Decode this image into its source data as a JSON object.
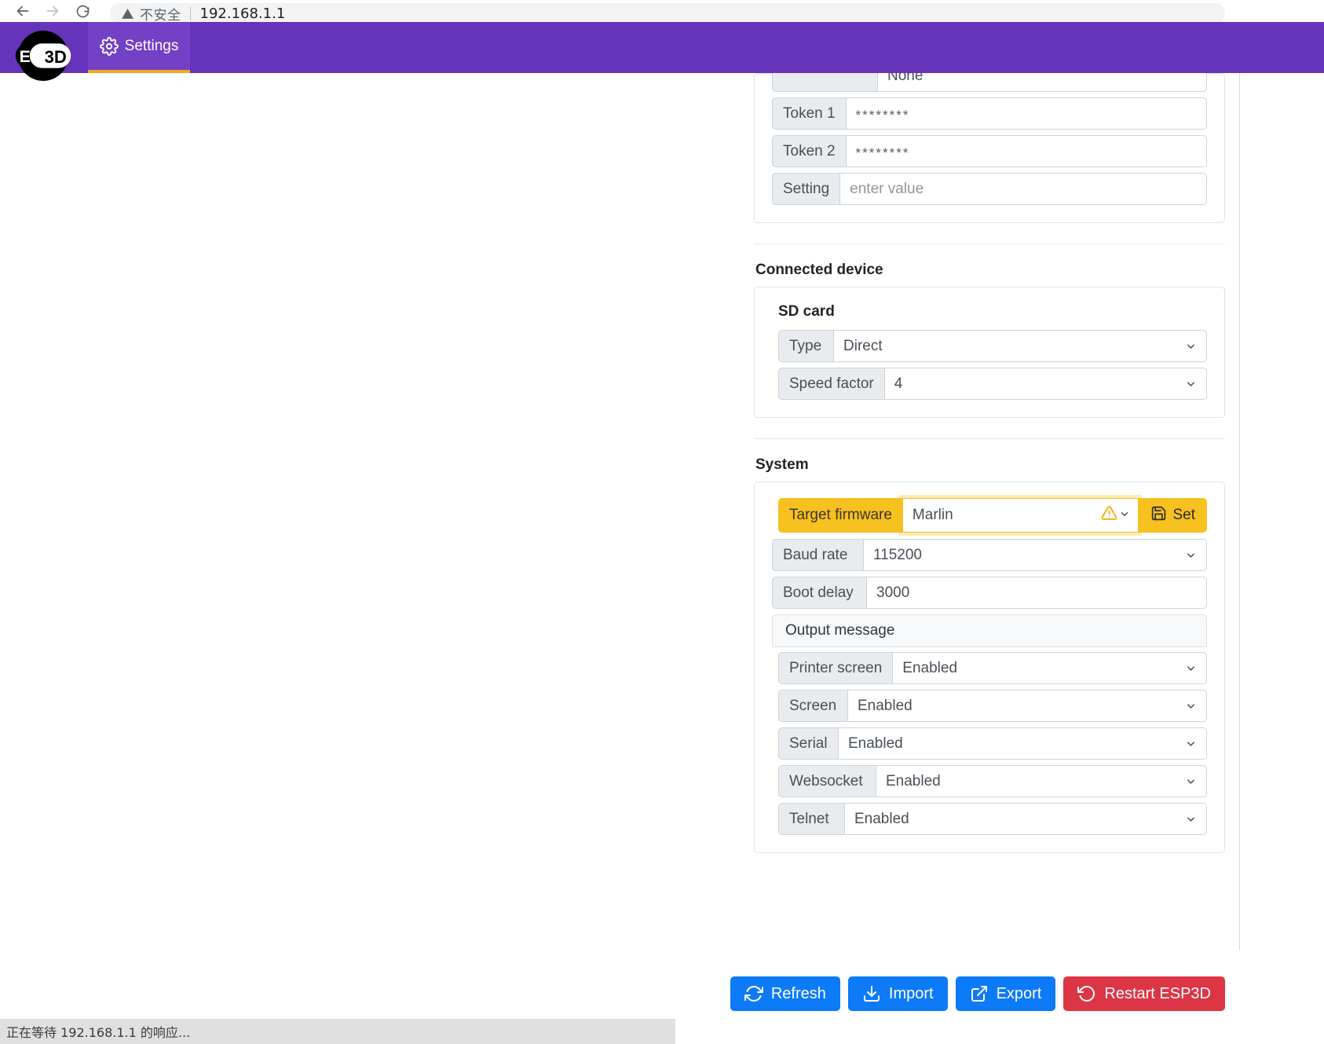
{
  "browser": {
    "back_icon": "arrow-left-icon",
    "forward_icon": "arrow-right-icon",
    "reload_icon": "reload-icon",
    "insecure_icon": "warning-triangle-icon",
    "insecure_label": "不安全",
    "url": "192.168.1.1"
  },
  "header": {
    "logo_text_left": "ESP",
    "logo_text_right": "3D",
    "tab_label": "Settings",
    "tab_icon": "gear-icon",
    "accent_color": "#6633bb",
    "tab_active_color": "#7340c6",
    "tab_underline_color": "#f5a623"
  },
  "auth_panel": {
    "partial_row": {
      "label": "",
      "value": "None"
    },
    "rows": [
      {
        "label": "Token 1",
        "value": "********",
        "type": "password"
      },
      {
        "label": "Token 2",
        "value": "********",
        "type": "password"
      },
      {
        "label": "Setting",
        "value": "enter value",
        "type": "placeholder"
      }
    ]
  },
  "connected_device": {
    "title": "Connected device",
    "sd_card": {
      "title": "SD card",
      "rows": [
        {
          "label": "Type",
          "value": "Direct",
          "type": "select"
        },
        {
          "label": "Speed factor",
          "value": "4",
          "type": "select"
        }
      ]
    }
  },
  "system": {
    "title": "System",
    "target_firmware": {
      "label": "Target firmware",
      "value": "Marlin",
      "warning_icon": "warning-triangle-icon",
      "chevron_icon": "chevron-down-icon",
      "set_button_label": "Set",
      "set_button_icon": "save-icon",
      "highlight_color": "#f7c11f"
    },
    "rows": [
      {
        "label": "Baud rate",
        "value": "115200",
        "type": "select"
      },
      {
        "label": "Boot delay",
        "value": "3000",
        "type": "text"
      }
    ],
    "output_message": {
      "title": "Output message",
      "rows": [
        {
          "label": "Printer screen",
          "value": "Enabled",
          "type": "select"
        },
        {
          "label": "Screen",
          "value": "Enabled",
          "type": "select"
        },
        {
          "label": "Serial",
          "value": "Enabled",
          "type": "select"
        },
        {
          "label": "Websocket",
          "value": "Enabled",
          "type": "select"
        },
        {
          "label": "Telnet",
          "value": "Enabled",
          "type": "select"
        }
      ]
    }
  },
  "actions": [
    {
      "label": "Refresh",
      "icon": "refresh-icon",
      "color": "#0d7af7",
      "style": "blue"
    },
    {
      "label": "Import",
      "icon": "download-icon",
      "color": "#0d7af7",
      "style": "blue"
    },
    {
      "label": "Export",
      "icon": "external-link-icon",
      "color": "#0d7af7",
      "style": "blue"
    },
    {
      "label": "Restart ESP3D",
      "icon": "restart-icon",
      "color": "#dc3545",
      "style": "red"
    }
  ],
  "statusbar": {
    "text": "正在等待 192.168.1.1 的响应..."
  }
}
